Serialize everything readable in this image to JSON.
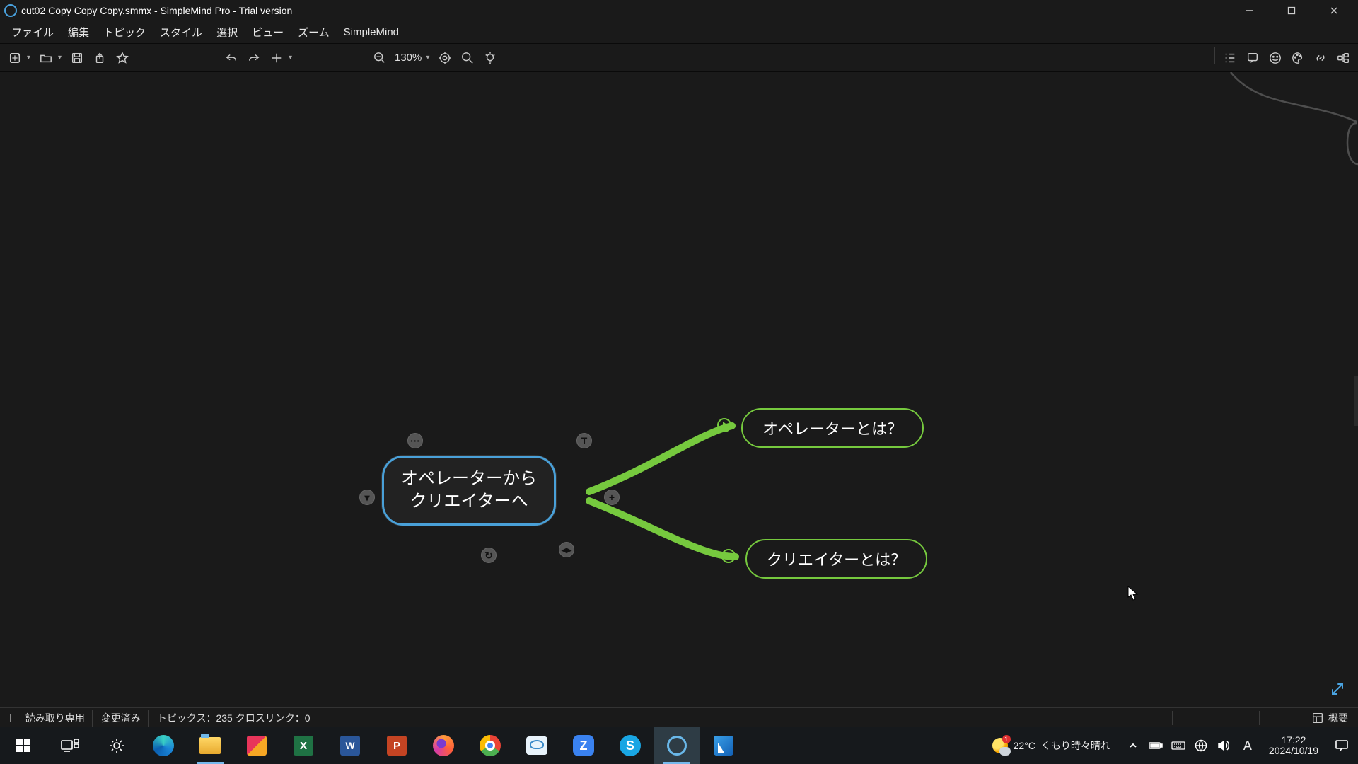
{
  "titlebar": {
    "title": "cut02 Copy Copy Copy.smmx - SimpleMind Pro - Trial version"
  },
  "menu": {
    "items": [
      "ファイル",
      "編集",
      "トピック",
      "スタイル",
      "選択",
      "ビュー",
      "ズーム",
      "SimpleMind"
    ]
  },
  "toolbar": {
    "zoom_label": "130%"
  },
  "mindmap": {
    "center": "オペレーターから\nクリエイターへ",
    "child1": "オペレーターとは？",
    "child2": "クリエイターとは？"
  },
  "statusbar": {
    "readonly": "読み取り専用",
    "modified": "変更済み",
    "topics": "トピックス：235 クロスリンク：0",
    "overview": "概要"
  },
  "taskbar": {
    "weather_temp": "22°C",
    "weather_desc": "くもり時々晴れ",
    "time": "17:22",
    "date": "2024/10/19",
    "ime": "A",
    "notif_badge": "1"
  }
}
